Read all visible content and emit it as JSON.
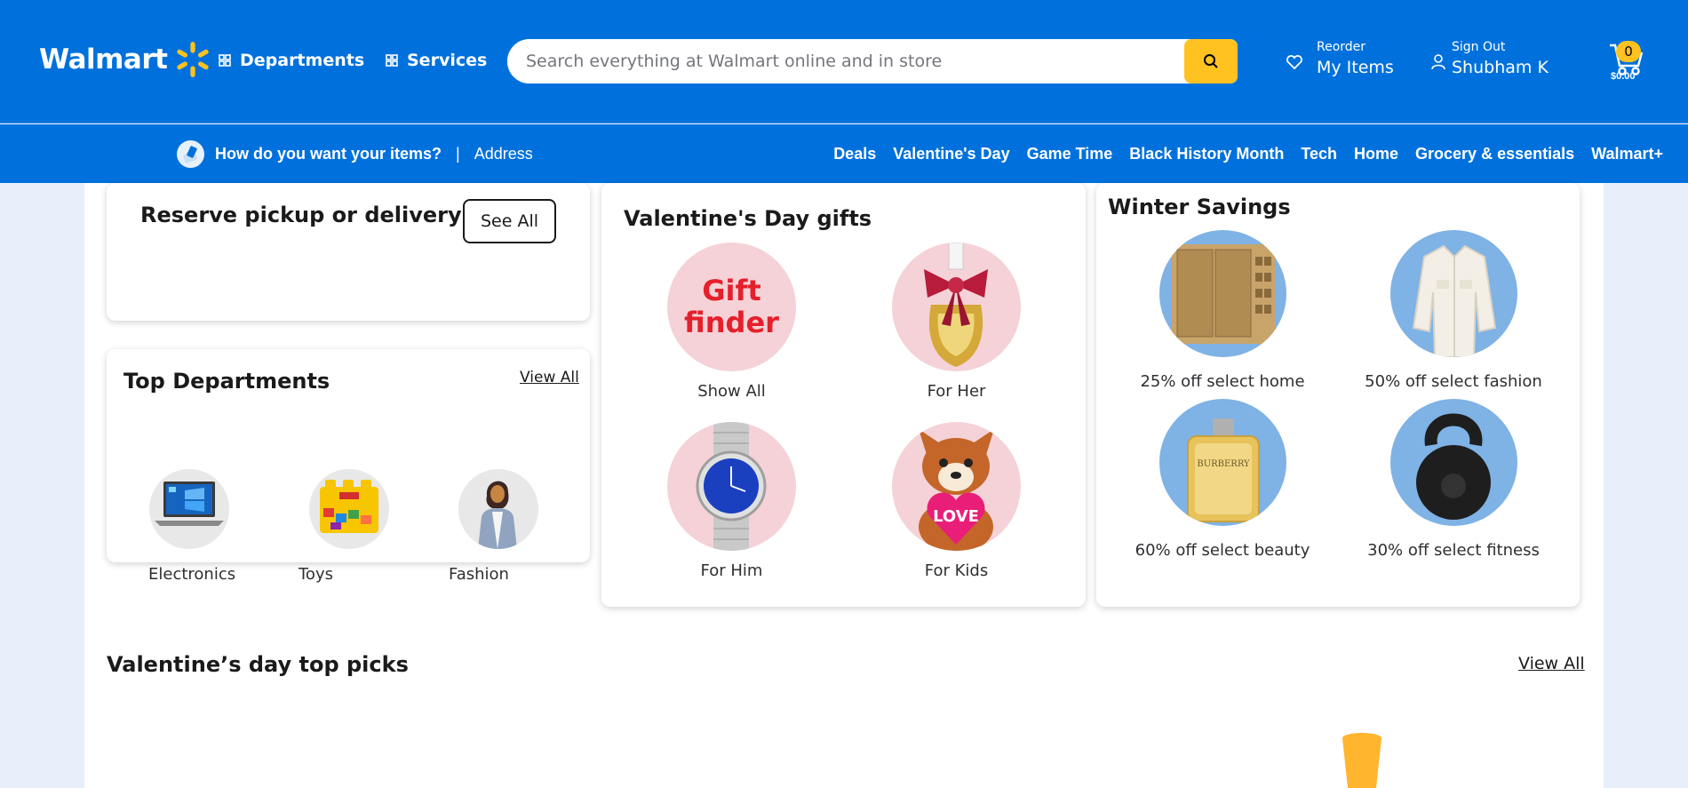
{
  "header": {
    "logo_text": "Walmart",
    "departments_label": "Departments",
    "services_label": "Services",
    "search_placeholder": "Search everything at Walmart online and in store",
    "reorder_small": "Reorder",
    "reorder_big": "My Items",
    "signout_small": "Sign Out",
    "user_name": "Shubham K",
    "cart_count": "0",
    "cart_total": "$0.00"
  },
  "subbar": {
    "question": "How do you want your items?",
    "separator": "|",
    "address": "Address",
    "categories": [
      "Deals",
      "Valentine's Day",
      "Game Time",
      "Black History Month",
      "Tech",
      "Home",
      "Grocery & essentials",
      "Walmart+"
    ]
  },
  "reserve": {
    "title": "Reserve pickup or delivery",
    "see_all": "See All"
  },
  "top_departments": {
    "title": "Top Departments",
    "view_all": "View All",
    "items": [
      "Electronics",
      "Toys",
      "Fashion"
    ]
  },
  "valentines": {
    "title": "Valentine's Day gifts",
    "gift_finder_line1": "Gift",
    "gift_finder_line2": "finder",
    "love_text": "LOVE",
    "items": [
      "Show All",
      "For Her",
      "For Him",
      "For Kids"
    ]
  },
  "winter": {
    "title": "Winter Savings",
    "perfume_brand": "BURBERRY",
    "items": [
      "25% off select home",
      "50% off select fashion",
      "60% off select beauty",
      "30% off select fitness"
    ]
  },
  "top_picks": {
    "title": "Valentine’s day top picks",
    "view_all": "View All"
  },
  "colors": {
    "brand_blue": "#0071dc",
    "spark_yellow": "#ffc220",
    "gift_circle": "#f5d2d7",
    "winter_circle": "#7fb2e5"
  }
}
